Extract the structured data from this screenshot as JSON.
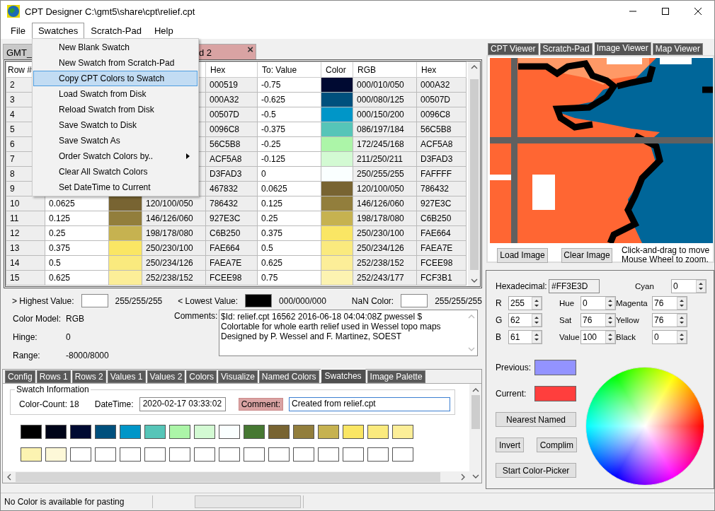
{
  "window": {
    "title": "CPT Designer C:\\gmt5\\share\\cpt\\relief.cpt"
  },
  "menu_bar": [
    {
      "label": "File",
      "selected": false
    },
    {
      "label": "Swatches",
      "selected": true
    },
    {
      "label": "Scratch-Pad",
      "selected": false
    },
    {
      "label": "Help",
      "selected": false
    }
  ],
  "open_menu": [
    {
      "label": "New Blank Swatch",
      "selected": false,
      "submenu": false
    },
    {
      "label": "New Swatch from Scratch-Pad",
      "selected": false,
      "submenu": false
    },
    {
      "label": "Copy CPT Colors to Swatch",
      "selected": true,
      "submenu": false
    },
    {
      "label": "Load Swatch from Disk",
      "selected": false,
      "submenu": false
    },
    {
      "label": "Reload Swatch from Disk",
      "selected": false,
      "submenu": false
    },
    {
      "label": "Save Swatch to Disk",
      "selected": false,
      "submenu": false
    },
    {
      "label": "Save Swatch As",
      "selected": false,
      "submenu": false
    },
    {
      "label": "Order Swatch Colors by..",
      "selected": false,
      "submenu": true
    },
    {
      "label": "Clear All Swatch Colors",
      "selected": false,
      "submenu": false
    },
    {
      "label": "Set DateTime to Current",
      "selected": false,
      "submenu": false
    }
  ],
  "doc_tabs": [
    {
      "label": "GMT_",
      "color": "#c9c9c9"
    },
    {
      "label": "d 2",
      "color": "#d9a3a3",
      "close": "×"
    }
  ],
  "table": {
    "columns": [
      "Row #",
      null,
      null,
      null,
      "Hex",
      "To: Value",
      "Color",
      "RGB",
      "Hex"
    ],
    "rows": [
      {
        "row": "2",
        "from": {
          "hex": "000519"
        },
        "to": {
          "value": "-0.75",
          "color": "#000a32",
          "rgb": "000/010/050",
          "hex": "000A32"
        }
      },
      {
        "row": "3",
        "from": {
          "hex": "000A32"
        },
        "to": {
          "value": "-0.625",
          "color": "#00507d",
          "rgb": "000/080/125",
          "hex": "00507D"
        }
      },
      {
        "row": "4",
        "from": {
          "hex": "00507D"
        },
        "to": {
          "value": "-0.5",
          "color": "#0096c8",
          "rgb": "000/150/200",
          "hex": "0096C8"
        }
      },
      {
        "row": "5",
        "from": {
          "hex": "0096C8"
        },
        "to": {
          "value": "-0.375",
          "color": "#56c5b8",
          "rgb": "086/197/184",
          "hex": "56C5B8"
        }
      },
      {
        "row": "6",
        "from": {
          "hex": "56C5B8"
        },
        "to": {
          "value": "-0.25",
          "color": "#acf5a8",
          "rgb": "172/245/168",
          "hex": "ACF5A8"
        }
      },
      {
        "row": "7",
        "from": {
          "hex": "ACF5A8"
        },
        "to": {
          "value": "-0.125",
          "color": "#d3fad3",
          "rgb": "211/250/211",
          "hex": "D3FAD3"
        }
      },
      {
        "row": "8",
        "from": {
          "hex": "D3FAD3"
        },
        "to": {
          "value": "0",
          "color": "#faffff",
          "rgb": "250/255/255",
          "hex": "FAFFFF"
        }
      },
      {
        "row": "9",
        "from": {
          "hex": "467832"
        },
        "to": {
          "value": "0.0625",
          "color": "#786432",
          "rgb": "120/100/050",
          "hex": "786432"
        }
      },
      {
        "row": "10",
        "from": {
          "value": "0.0625",
          "color": "#786432",
          "rgb": "120/100/050",
          "hex": "786432"
        },
        "to": {
          "value": "0.125",
          "color": "#927e3c",
          "rgb": "146/126/060",
          "hex": "927E3C"
        }
      },
      {
        "row": "11",
        "from": {
          "value": "0.125",
          "color": "#927e3c",
          "rgb": "146/126/060",
          "hex": "927E3C"
        },
        "to": {
          "value": "0.25",
          "color": "#c6b250",
          "rgb": "198/178/080",
          "hex": "C6B250"
        }
      },
      {
        "row": "12",
        "from": {
          "value": "0.25",
          "color": "#c6b250",
          "rgb": "198/178/080",
          "hex": "C6B250"
        },
        "to": {
          "value": "0.375",
          "color": "#fae664",
          "rgb": "250/230/100",
          "hex": "FAE664"
        }
      },
      {
        "row": "13",
        "from": {
          "value": "0.375",
          "color": "#fae664",
          "rgb": "250/230/100",
          "hex": "FAE664"
        },
        "to": {
          "value": "0.5",
          "color": "#faea7e",
          "rgb": "250/234/126",
          "hex": "FAEA7E"
        }
      },
      {
        "row": "14",
        "from": {
          "value": "0.5",
          "color": "#faea7e",
          "rgb": "250/234/126",
          "hex": "FAEA7E"
        },
        "to": {
          "value": "0.625",
          "color": "#fcee98",
          "rgb": "252/238/152",
          "hex": "FCEE98"
        }
      },
      {
        "row": "15",
        "from": {
          "value": "0.625",
          "color": "#fcee98",
          "rgb": "252/238/152",
          "hex": "FCEE98"
        },
        "to": {
          "value": "0.75",
          "color": "#fcf3b1",
          "rgb": "252/243/177",
          "hex": "FCF3B1"
        }
      }
    ]
  },
  "special_colors": [
    {
      "label": "> Highest Value:",
      "color": "#ffffff",
      "rgb": "255/255/255"
    },
    {
      "label": "< Lowest Value:",
      "color": "#000000",
      "rgb": "000/000/000"
    },
    {
      "label": "NaN Color:",
      "color": "#ffffff",
      "rgb": "255/255/255"
    }
  ],
  "properties": [
    {
      "label": "Color Model:",
      "value": "RGB"
    },
    {
      "label": "Hinge:",
      "value": "0"
    },
    {
      "label": "Range:",
      "value": "-8000/8000"
    }
  ],
  "comments": {
    "label": "Comments:",
    "text": "$Id: relief.cpt 16562 2016-06-18 04:04:08Z pwessel $\nColortable for whole earth relief used in Wessel topo maps\nDesigned by P. Wessel and F. Martinez, SOEST"
  },
  "bottom_tabs": [
    {
      "label": "Config",
      "selected": false
    },
    {
      "label": "Rows 1",
      "selected": false
    },
    {
      "label": "Rows 2",
      "selected": false
    },
    {
      "label": "Values 1",
      "selected": false
    },
    {
      "label": "Values 2",
      "selected": false
    },
    {
      "label": "Colors",
      "selected": false
    },
    {
      "label": "Visualize",
      "selected": false
    },
    {
      "label": "Named Colors",
      "selected": false
    },
    {
      "label": "Swatches",
      "selected": true
    },
    {
      "label": "Image Palette",
      "selected": false
    }
  ],
  "swatch_info": {
    "group_title": "Swatch Information",
    "color_count": "Color-Count: 18",
    "datetime_label": "DateTime:",
    "datetime": "2020-02-17 03:33:02",
    "comment_label": "Comment:",
    "comment": "Created from relief.cpt"
  },
  "swatches": [
    {
      "kind": "color",
      "color": "#000000"
    },
    {
      "kind": "color",
      "color": "#000519"
    },
    {
      "kind": "color",
      "color": "#000a32"
    },
    {
      "kind": "color",
      "color": "#00507d"
    },
    {
      "kind": "color",
      "color": "#0096c8"
    },
    {
      "kind": "color",
      "color": "#56c5b8"
    },
    {
      "kind": "color",
      "color": "#acf5a8"
    },
    {
      "kind": "color",
      "color": "#d3fad3"
    },
    {
      "kind": "color",
      "color": "#faffff"
    },
    {
      "kind": "color",
      "color": "#467832"
    },
    {
      "kind": "color",
      "color": "#786432"
    },
    {
      "kind": "color",
      "color": "#927e3c"
    },
    {
      "kind": "color",
      "color": "#c6b250"
    },
    {
      "kind": "color",
      "color": "#fae664"
    },
    {
      "kind": "color",
      "color": "#faea7e"
    },
    {
      "kind": "color",
      "color": "#fcee98"
    },
    {
      "kind": "color",
      "color": "#fcf3b1"
    },
    {
      "kind": "color",
      "color": "#fdf8d8"
    },
    {
      "kind": "empty"
    },
    {
      "kind": "empty"
    },
    {
      "kind": "empty"
    },
    {
      "kind": "empty"
    },
    {
      "kind": "empty"
    },
    {
      "kind": "empty"
    },
    {
      "kind": "empty"
    },
    {
      "kind": "empty"
    },
    {
      "kind": "empty"
    },
    {
      "kind": "empty"
    },
    {
      "kind": "empty"
    },
    {
      "kind": "empty"
    },
    {
      "kind": "empty"
    },
    {
      "kind": "empty"
    }
  ],
  "status_bar": {
    "text": "No Color is available for pasting"
  },
  "viewer_tabs": [
    {
      "label": "CPT Viewer",
      "selected": false
    },
    {
      "label": "Scratch-Pad",
      "selected": false
    },
    {
      "label": "Image Viewer",
      "selected": true
    },
    {
      "label": "Map Viewer",
      "selected": false
    }
  ],
  "image_viewer": {
    "buttons": [
      "Load Image",
      "Clear Image"
    ],
    "hint": "Click-and-drag to move\nMouse Wheel to zoom."
  },
  "color_editor": {
    "hex_label": "Hexadecimal:",
    "hex_value": "#FF3E3D",
    "columns": [
      [
        {
          "label": "R",
          "value": "255"
        },
        {
          "label": "G",
          "value": "62"
        },
        {
          "label": "B",
          "value": "61"
        }
      ],
      [
        {
          "label": "Hue",
          "value": "0"
        },
        {
          "label": "Sat",
          "value": "76"
        },
        {
          "label": "Value",
          "value": "100"
        }
      ]
    ],
    "cmyk": [
      {
        "label": "Cyan",
        "value": "0"
      },
      {
        "label": "Magenta",
        "value": "76"
      },
      {
        "label": "Yellow",
        "value": "76"
      },
      {
        "label": "Black",
        "value": "0"
      }
    ],
    "previous": {
      "label": "Previous:",
      "color": "#9393ff"
    },
    "current": {
      "label": "Current:",
      "color": "#ff3e3d"
    },
    "buttons": [
      "Nearest Named",
      "Invert",
      "Complim",
      "Start Color-Picker"
    ]
  }
}
